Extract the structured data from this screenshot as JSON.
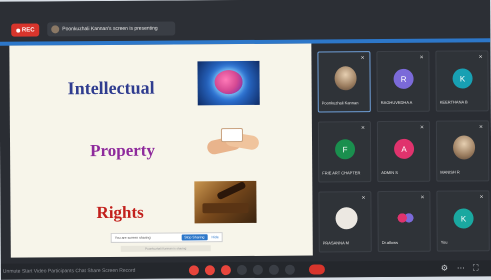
{
  "app": {
    "rec_label": "REC"
  },
  "presenting": {
    "label": "Poonkuzhali Kannan's screen is presenting"
  },
  "slide": {
    "words": [
      "Intellectual",
      "Property",
      "Rights"
    ],
    "share_bar": {
      "text": "You are screen sharing",
      "stop_label": "Stop Sharing",
      "hide_label": "Hide"
    },
    "footer_text": "Poonkuzhali Kannan is sharing"
  },
  "gallery": {
    "tiles": [
      {
        "name": "Poonkuzhali Kannan",
        "initial": "",
        "kind": "photo",
        "color": "#2f3338"
      },
      {
        "name": "RAGHUVEDHA A",
        "initial": "R",
        "kind": "initial",
        "color": "#7b6ad9"
      },
      {
        "name": "KEERTHANA B",
        "initial": "K",
        "kind": "initial",
        "color": "#18a0b3"
      },
      {
        "name": "FRIE ART CHAPTER",
        "initial": "F",
        "kind": "initial",
        "color": "#1a8f4e"
      },
      {
        "name": "ADMIN S",
        "initial": "A",
        "kind": "initial",
        "color": "#e0336d"
      },
      {
        "name": "MANISH R",
        "initial": "",
        "kind": "photo",
        "color": "#2f3338"
      },
      {
        "name": "PRASANNA M",
        "initial": "",
        "kind": "logo",
        "color": "#2f3338"
      },
      {
        "name": "Dr.allows",
        "initial": "",
        "kind": "dots",
        "color": "#2f3338"
      },
      {
        "name": "You",
        "initial": "K",
        "kind": "initial",
        "color": "#1aa8a0"
      }
    ]
  },
  "toolbar": {
    "left_text": "Unmute  Start Video  Participants  Chat  Share Screen  Record"
  },
  "colors": {
    "accent": "#2d77c9",
    "rec": "#d8352c"
  }
}
